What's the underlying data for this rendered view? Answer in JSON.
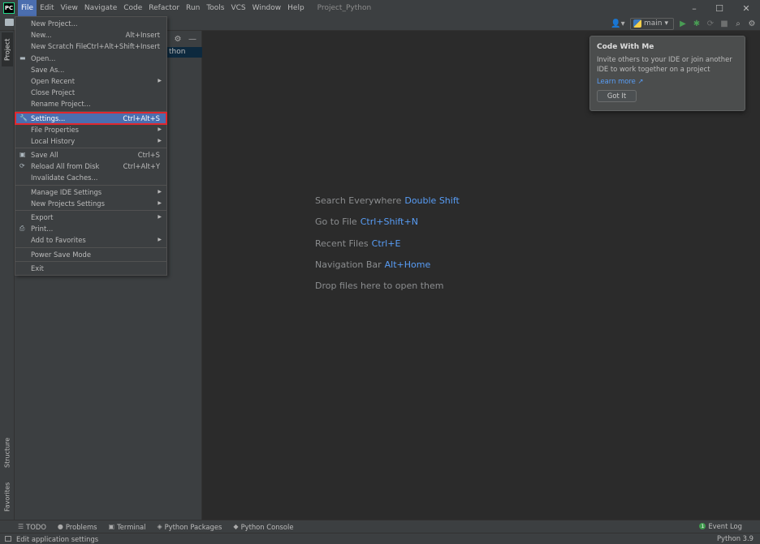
{
  "titlebar": {
    "logo": "PC",
    "menus": [
      "File",
      "Edit",
      "View",
      "Navigate",
      "Code",
      "Refactor",
      "Run",
      "Tools",
      "VCS",
      "Window",
      "Help"
    ],
    "project_title": "Project_Python",
    "minimize": "–",
    "maximize": "☐",
    "close": "✕"
  },
  "toolbar": {
    "branch": "main",
    "branch_arrow": "▾",
    "user_icon": "👤▾",
    "run_icon": "▶",
    "debug_icon": "✱",
    "coverage_icon": "⟳",
    "stop_icon": "■",
    "search_icon": "⌕",
    "settings_icon": "⚙",
    "run_color": "#499c54"
  },
  "left_strip": {
    "project_tab": "Project",
    "structure_tab": "Structure",
    "favorites_tab": "Favorites"
  },
  "project_panel": {
    "gear_icon": "⚙",
    "minimize_icon": "—",
    "root_label": "thon"
  },
  "editor": {
    "hints": [
      {
        "label": "Search Everywhere",
        "key": "Double Shift"
      },
      {
        "label": "Go to File",
        "key": "Ctrl+Shift+N"
      },
      {
        "label": "Recent Files",
        "key": "Ctrl+E"
      },
      {
        "label": "Navigation Bar",
        "key": "Alt+Home"
      },
      {
        "label": "Drop files here to open them",
        "key": ""
      }
    ]
  },
  "file_menu": {
    "items": [
      {
        "label": "New Project...",
        "shortcut": "",
        "arrow": false,
        "icon": ""
      },
      {
        "label": "New...",
        "shortcut": "Alt+Insert",
        "arrow": false,
        "icon": ""
      },
      {
        "label": "New Scratch File",
        "shortcut": "Ctrl+Alt+Shift+Insert",
        "arrow": false,
        "icon": ""
      },
      {
        "label": "Open...",
        "shortcut": "",
        "arrow": false,
        "icon": "▬"
      },
      {
        "label": "Save As...",
        "shortcut": "",
        "arrow": false,
        "icon": ""
      },
      {
        "label": "Open Recent",
        "shortcut": "",
        "arrow": true,
        "icon": ""
      },
      {
        "label": "Close Project",
        "shortcut": "",
        "arrow": false,
        "icon": ""
      },
      {
        "label": "Rename Project...",
        "shortcut": "",
        "arrow": false,
        "icon": ""
      },
      {
        "label": "Settings...",
        "shortcut": "Ctrl+Alt+S",
        "arrow": false,
        "icon": "🔧"
      },
      {
        "label": "File Properties",
        "shortcut": "",
        "arrow": true,
        "icon": ""
      },
      {
        "label": "Local History",
        "shortcut": "",
        "arrow": true,
        "icon": ""
      },
      {
        "label": "Save All",
        "shortcut": "Ctrl+S",
        "arrow": false,
        "icon": "▣"
      },
      {
        "label": "Reload All from Disk",
        "shortcut": "Ctrl+Alt+Y",
        "arrow": false,
        "icon": "⟳"
      },
      {
        "label": "Invalidate Caches...",
        "shortcut": "",
        "arrow": false,
        "icon": ""
      },
      {
        "label": "Manage IDE Settings",
        "shortcut": "",
        "arrow": true,
        "icon": ""
      },
      {
        "label": "New Projects Settings",
        "shortcut": "",
        "arrow": true,
        "icon": ""
      },
      {
        "label": "Export",
        "shortcut": "",
        "arrow": true,
        "icon": ""
      },
      {
        "label": "Print...",
        "shortcut": "",
        "arrow": false,
        "icon": "⎙"
      },
      {
        "label": "Add to Favorites",
        "shortcut": "",
        "arrow": true,
        "icon": ""
      },
      {
        "label": "Power Save Mode",
        "shortcut": "",
        "arrow": false,
        "icon": ""
      },
      {
        "label": "Exit",
        "shortcut": "",
        "arrow": false,
        "icon": ""
      }
    ],
    "arrow_glyph": "▶"
  },
  "popup": {
    "title": "Code With Me",
    "description": "Invite others to your IDE or join another IDE to work together on a project",
    "link": "Learn more ↗",
    "button": "Got It"
  },
  "bottom_tools": {
    "items": [
      {
        "icon": "☰",
        "label": "TODO"
      },
      {
        "icon": "●",
        "label": "Problems"
      },
      {
        "icon": "▣",
        "label": "Terminal"
      },
      {
        "icon": "◈",
        "label": "Python Packages"
      },
      {
        "icon": "◆",
        "label": "Python Console"
      }
    ],
    "event_log": "Event Log",
    "event_count": "1"
  },
  "statusbar": {
    "text": "Edit application settings",
    "interpreter": "Python 3.9"
  }
}
